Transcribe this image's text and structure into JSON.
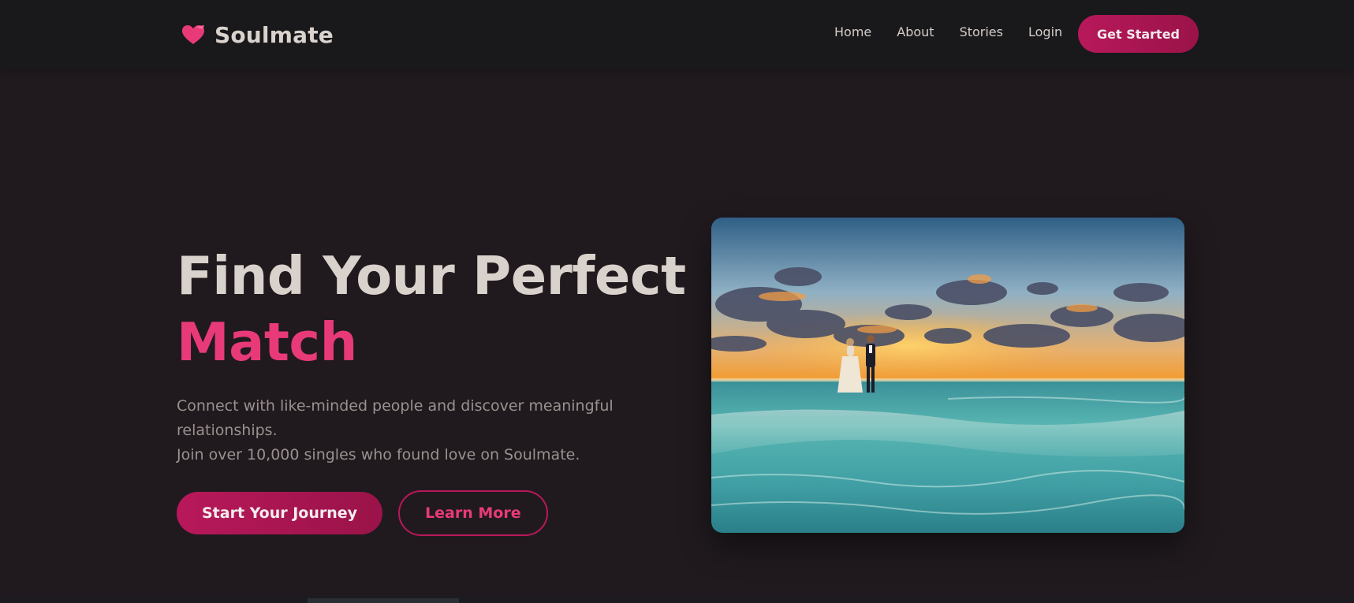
{
  "brand": {
    "name": "Soulmate",
    "icon": "heart-icon",
    "accent_color": "#e83a78"
  },
  "nav": {
    "links": [
      "Home",
      "About",
      "Stories",
      "Login"
    ],
    "cta_label": "Get Started"
  },
  "hero": {
    "title_line1": "Find Your Perfect",
    "title_accent": "Match",
    "subtitle_line1": "Connect with like-minded people and discover meaningful relationships.",
    "subtitle_line2": "Join over 10,000 singles who found love on Soulmate.",
    "primary_button": "Start Your Journey",
    "secondary_button": "Learn More",
    "image_icon": "couple-beach-sunset-photo"
  },
  "colors": {
    "background": "#201a1e",
    "navbar": "#19191b",
    "primary": "#b8185a",
    "accent": "#e83a78",
    "text": "#d9d2cc",
    "muted_text": "#9a918f"
  }
}
